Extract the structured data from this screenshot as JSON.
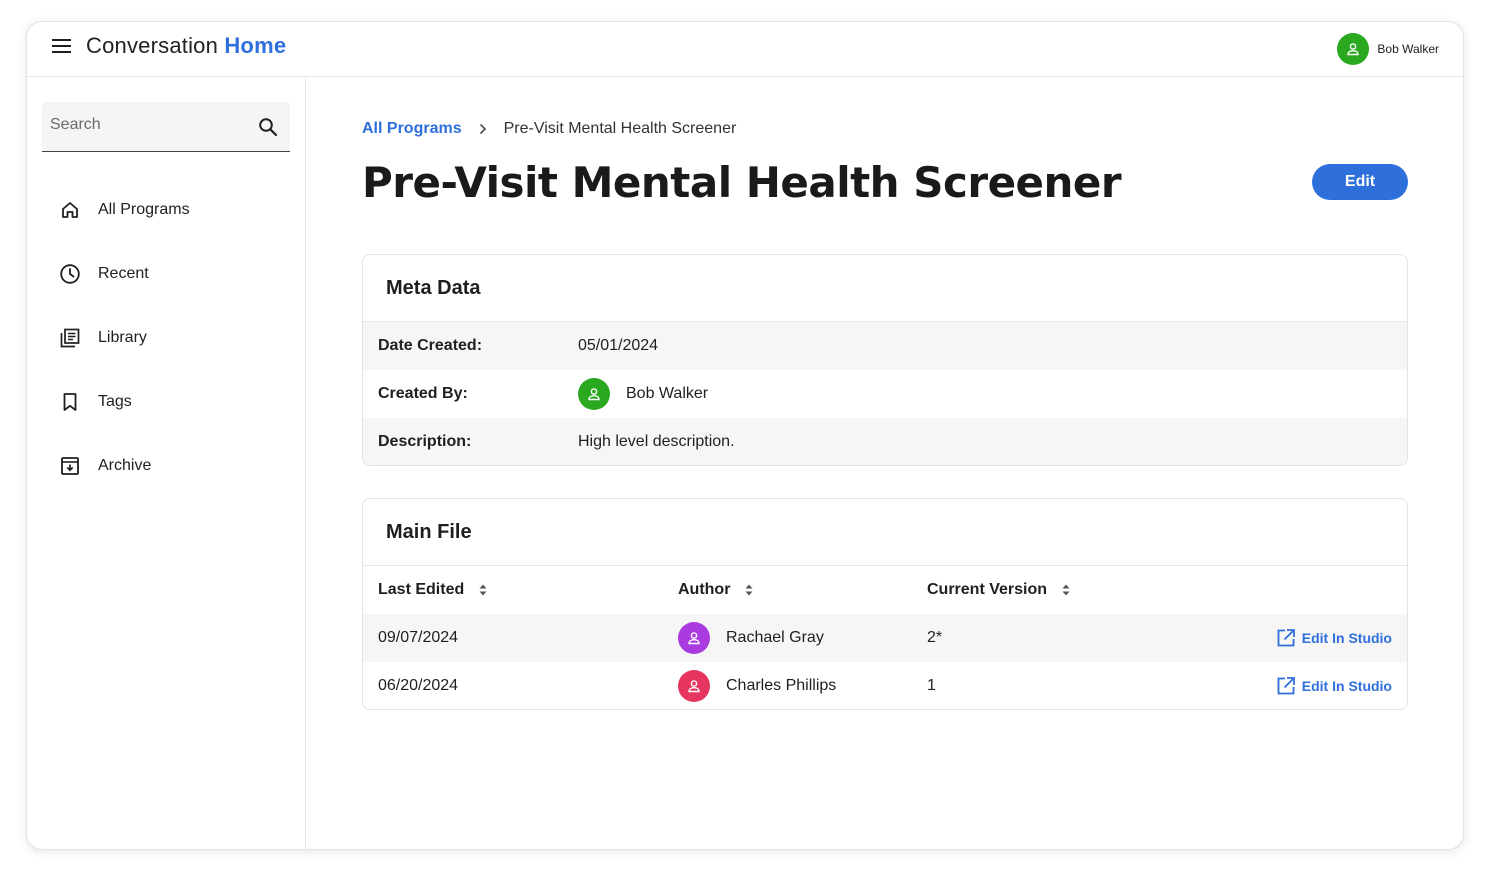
{
  "header": {
    "title_prefix": "Conversation",
    "title_accent": "Home",
    "user_name": "Bob Walker",
    "user_avatar_color": "#2aa820"
  },
  "sidebar": {
    "search_placeholder": "Search",
    "items": [
      {
        "label": "All Programs",
        "icon": "home-icon"
      },
      {
        "label": "Recent",
        "icon": "clock-icon"
      },
      {
        "label": "Library",
        "icon": "library-icon"
      },
      {
        "label": "Tags",
        "icon": "bookmark-icon"
      },
      {
        "label": "Archive",
        "icon": "archive-icon"
      }
    ]
  },
  "breadcrumb": {
    "root": "All Programs",
    "current": "Pre-Visit Mental Health Screener"
  },
  "page": {
    "title": "Pre-Visit Mental Health Screener",
    "edit_label": "Edit"
  },
  "meta": {
    "heading": "Meta Data",
    "rows": [
      {
        "key": "Date Created:",
        "value": "05/01/2024"
      },
      {
        "key": "Created By:",
        "value": "Bob Walker",
        "avatar_color": "#2aa820"
      },
      {
        "key": "Description:",
        "value": "High level description."
      }
    ]
  },
  "file": {
    "heading": "Main File",
    "columns": [
      "Last Edited",
      "Author",
      "Current Version"
    ],
    "rows": [
      {
        "last_edited": "09/07/2024",
        "author": "Rachael Gray",
        "avatar_color": "#a93be0",
        "version": "2*",
        "action": "Edit In Studio"
      },
      {
        "last_edited": "06/20/2024",
        "author": "Charles Phillips",
        "avatar_color": "#e6365f",
        "version": "1",
        "action": "Edit In Studio"
      }
    ]
  },
  "colors": {
    "accent": "#2f6fdc"
  }
}
